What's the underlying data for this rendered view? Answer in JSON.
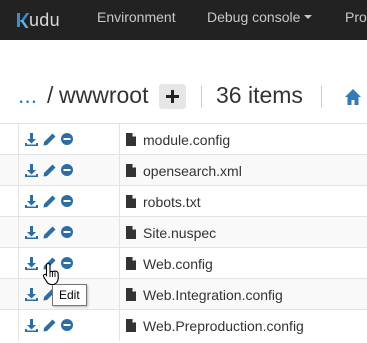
{
  "navbar": {
    "brand": "udu",
    "items": [
      {
        "label": "Environment"
      },
      {
        "label": "Debug console"
      },
      {
        "label": "Pro"
      }
    ]
  },
  "path": {
    "ellipsis": "...",
    "separator": "/",
    "folder": "wwwroot",
    "item_count": "36 items"
  },
  "files": [
    {
      "name": "module.config"
    },
    {
      "name": "opensearch.xml"
    },
    {
      "name": "robots.txt"
    },
    {
      "name": "Site.nuspec"
    },
    {
      "name": "Web.config"
    },
    {
      "name": "Web.Integration.config"
    },
    {
      "name": "Web.Preproduction.config"
    }
  ],
  "tooltip": {
    "text": "Edit"
  },
  "colors": {
    "navbar_bg": "#222222",
    "brand_accent": "#3a90cf",
    "action_icon": "#2e6da4",
    "link": "#337ab7",
    "text": "#333333"
  },
  "icons": {
    "row_actions": [
      "download-icon",
      "pencil-icon",
      "minus-circle-icon"
    ],
    "file": "file-icon",
    "home": "home-icon",
    "add": "plus-icon"
  }
}
